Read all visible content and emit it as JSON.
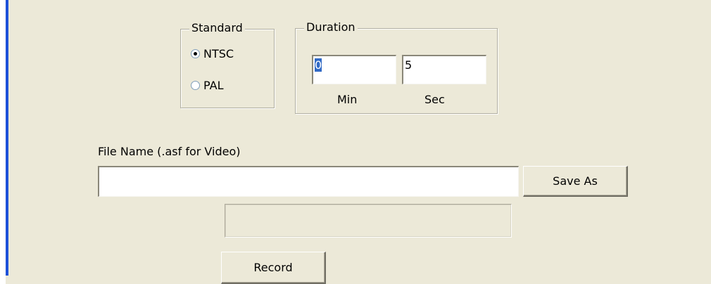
{
  "standard": {
    "legend": "Standard",
    "options": [
      {
        "label": "NTSC",
        "checked": true
      },
      {
        "label": "PAL",
        "checked": false
      }
    ]
  },
  "duration": {
    "legend": "Duration",
    "min_value": "0",
    "sec_value": "5",
    "min_label": "Min",
    "sec_label": "Sec"
  },
  "file": {
    "label": "File Name (.asf for Video)",
    "value": "",
    "save_as_label": "Save As"
  },
  "status": {
    "value": ""
  },
  "record_label": "Record",
  "colors": {
    "window_bg": "#ece9d8",
    "accent_bar": "#1d51d9",
    "selection": "#316ac5"
  }
}
